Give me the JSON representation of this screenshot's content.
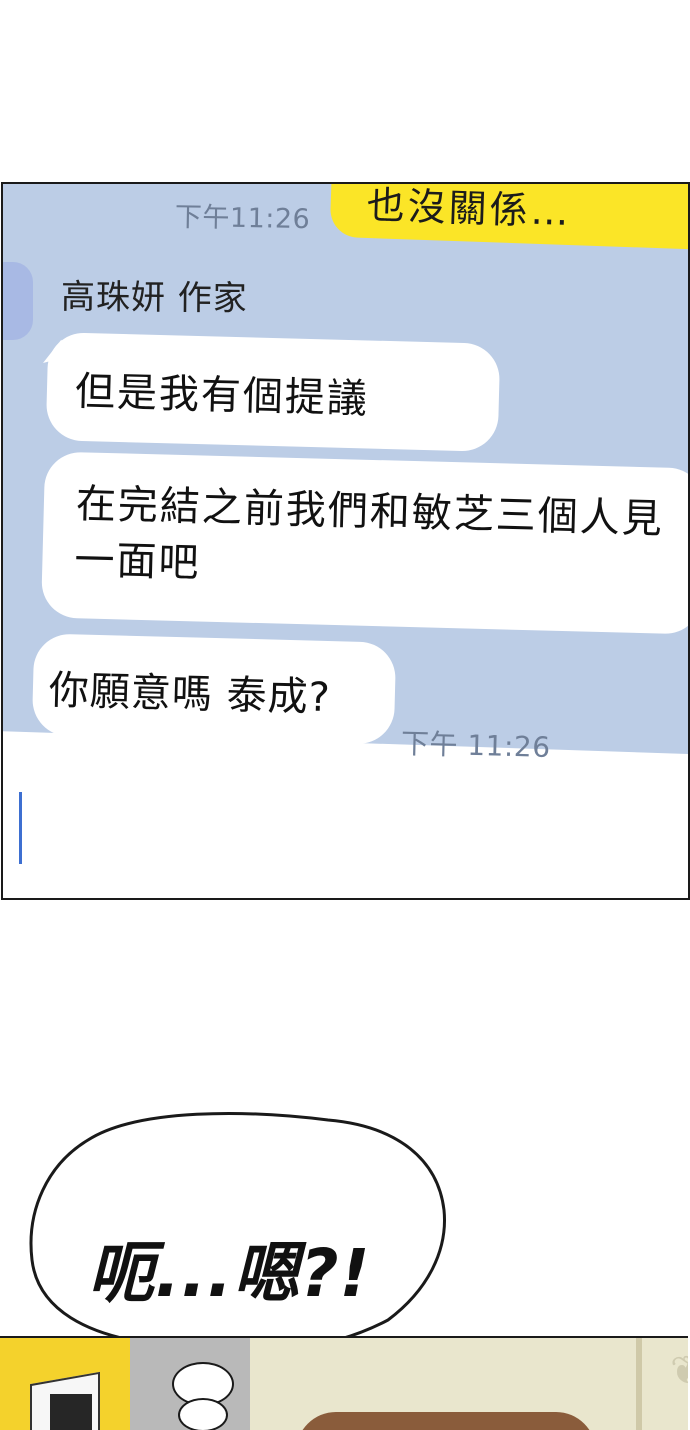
{
  "chat": {
    "outgoing_message": "也沒關係…",
    "timestamp_top": "下午11:26",
    "sender_name": "高珠妍 作家",
    "messages": [
      "但是我有個提議",
      "在完結之前我們和敏芝三個人見一面吧",
      "你願意嗎 泰成?"
    ],
    "timestamp_bottom": "下午 11:26"
  },
  "speech": {
    "text": "呃...嗯?!"
  },
  "colors": {
    "chat_background": "#bccde6",
    "outgoing_bubble": "#fbe527",
    "incoming_bubble": "#ffffff",
    "timestamp": "#6f7f98",
    "cursor": "#3d6fd1"
  }
}
